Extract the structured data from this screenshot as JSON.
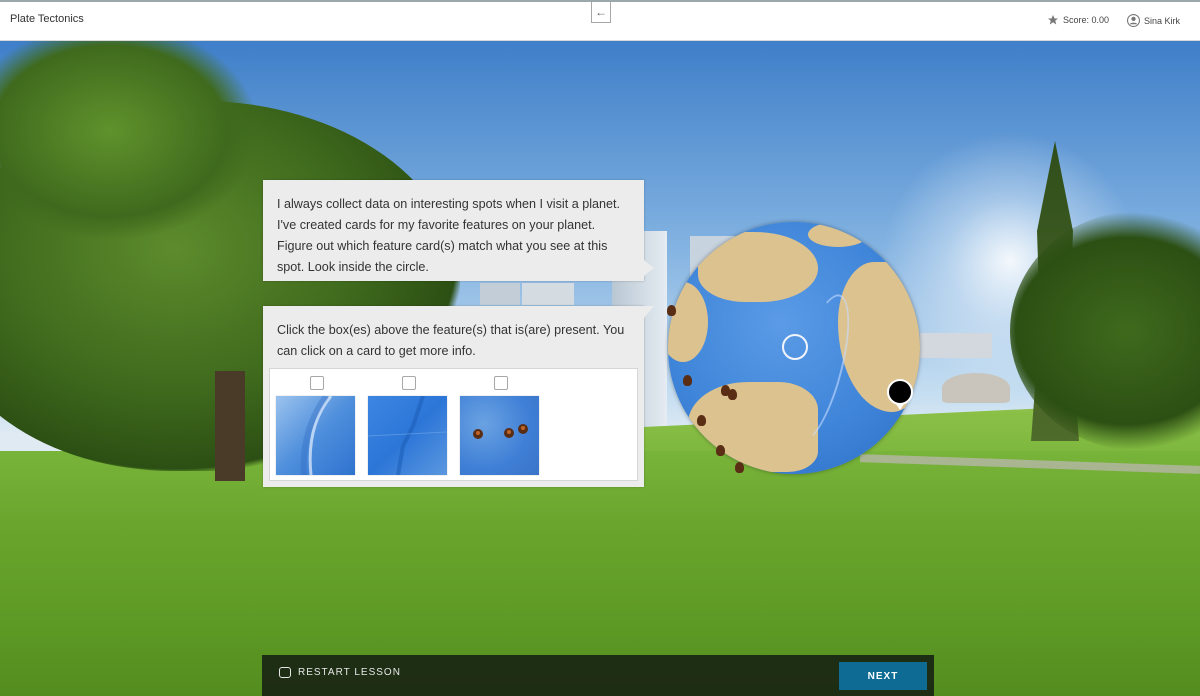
{
  "header": {
    "app_title": "Plate Tectonics",
    "back_icon": "arrow-left-icon",
    "score_label": "Score: 0.00",
    "score_icon": "star-icon",
    "user_name": "Sina Kirk",
    "user_icon": "user-circle-icon"
  },
  "prompt": {
    "intro_text": "I always collect data on interesting spots when I visit a planet. I've created cards for my favorite features on your planet. Figure out which feature card(s) match what you see at this spot. Look inside the circle.",
    "instruction_text": "Click the box(es) above the feature(s) that is(are) present. You can click on a card to get more info."
  },
  "cards": [
    {
      "checked": false,
      "icon": "trench-feature-card"
    },
    {
      "checked": false,
      "icon": "ridge-feature-card"
    },
    {
      "checked": false,
      "icon": "volcano-chain-feature-card"
    }
  ],
  "footer": {
    "restart_label": "RESTART LESSON",
    "restart_icon": "restart-icon",
    "next_label": "NEXT",
    "next_color": "#0d6b94"
  },
  "colors": {
    "ocean": "#3f85d9",
    "land": "#dcc28e",
    "bubble": "#ececec"
  }
}
